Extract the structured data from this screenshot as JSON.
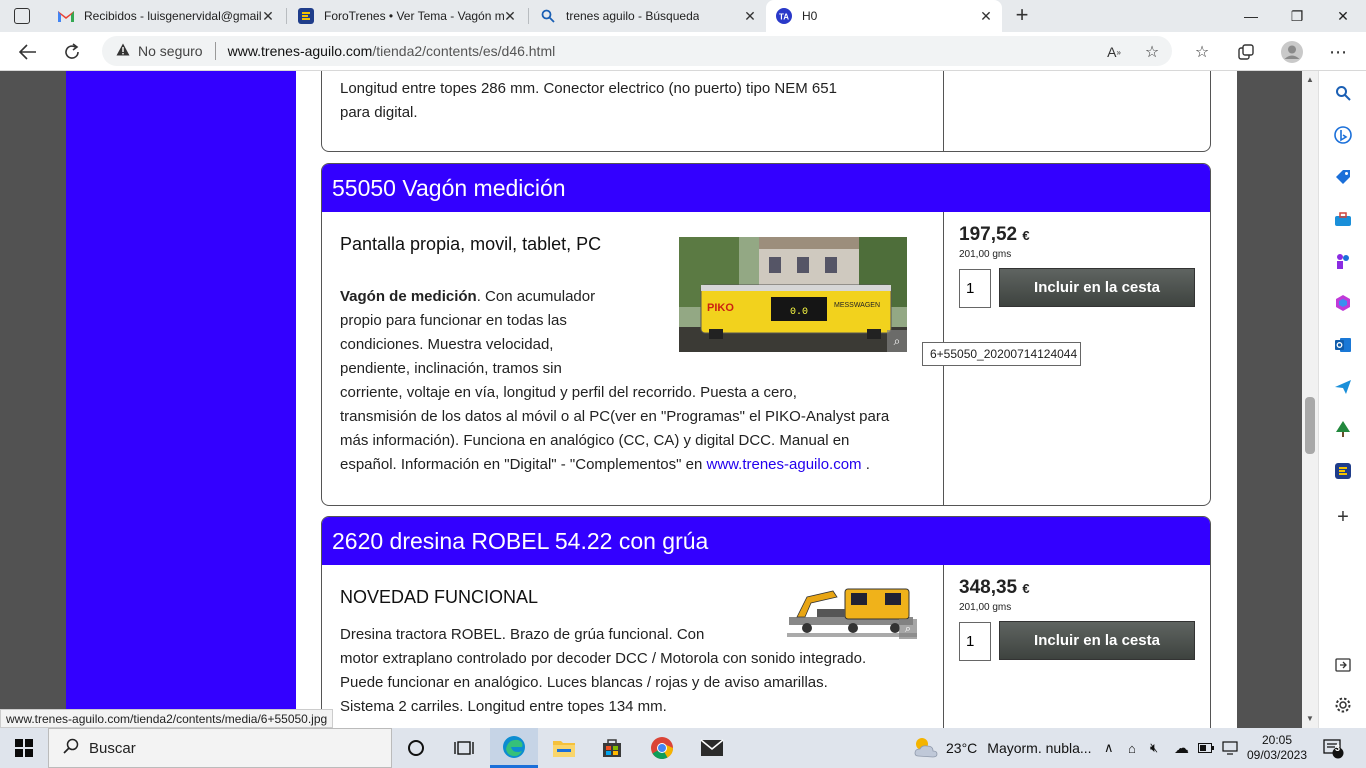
{
  "tabs": [
    {
      "title": "Recibidos - luisgenervidal@gmail",
      "icon": "gmail-icon"
    },
    {
      "title": "ForoTrenes • Ver Tema - Vagón m",
      "icon": "forotrenes-icon"
    },
    {
      "title": "trenes aguilo - Búsqueda",
      "icon": "search-icon"
    },
    {
      "title": "H0",
      "icon": "ta-icon"
    }
  ],
  "window": {
    "minimize": "—",
    "maximize": "❐",
    "close": "✕"
  },
  "address": {
    "security": "No seguro",
    "host": "www.trenes-aguilo.com",
    "path": "/tienda2/contents/es/d46.html"
  },
  "prev_item": {
    "text_line1": "Longitud entre topes 286 mm. Conector electrico (no puerto) tipo NEM 651",
    "text_line2": "para digital."
  },
  "product1": {
    "title": "55050 Vagón medición",
    "subtitle": "Pantalla propia, movil, tablet, PC",
    "bold": "Vagón de medición",
    "desc_l1": ". Con acumulador",
    "desc_l2": "propio para funcionar en todas las",
    "desc_l3": "condiciones. Muestra velocidad,",
    "desc_l4": "pendiente, inclinación, tramos sin",
    "desc_l5": "corriente, voltaje en vía, longitud y perfil del recorrido. Puesta a cero,",
    "desc_l6": "transmisión de los datos al móvil o al PC(ver en \"Programas\" el PIKO-Analyst para",
    "desc_l7": "más información). Funciona en analógico (CC, CA) y digital DCC. Manual en",
    "desc_l8": "español. Información en \"Digital\" - \"Complementos\" en ",
    "link": "www.trenes-aguilo.com",
    "desc_end": " .",
    "price": "197,52",
    "currency": "€",
    "weight": "201,00 gms",
    "qty": "1",
    "cart": "Incluir en la cesta",
    "tooltip": "6+55050_20200714124044",
    "img_brand": "PIKO",
    "img_label": "MESSWAGEN",
    "img_display": "0.0"
  },
  "product2": {
    "title": "2620 dresina ROBEL 54.22 con grúa",
    "subtitle": "NOVEDAD FUNCIONAL",
    "desc_l1": "Dresina tractora ROBEL. Brazo de grúa funcional. Con",
    "desc_l2": "motor extraplano controlado por decoder DCC / Motorola con sonido integrado.",
    "desc_l3": "Puede funcionar en analógico. Luces blancas / rojas y de aviso amarillas.",
    "desc_l4": "Sistema 2 carriles. Longitud entre topes 134 mm.",
    "price": "348,35",
    "currency": "€",
    "weight": "201,00 gms",
    "qty": "1",
    "cart": "Incluir en la cesta"
  },
  "statusbar": "www.trenes-aguilo.com/tienda2/contents/media/6+55050.jpg",
  "taskbar": {
    "search": "Buscar",
    "temp": "23°C",
    "weather": "Mayorm. nubla...",
    "time": "20:05",
    "date": "09/03/2023",
    "notif": "3"
  }
}
